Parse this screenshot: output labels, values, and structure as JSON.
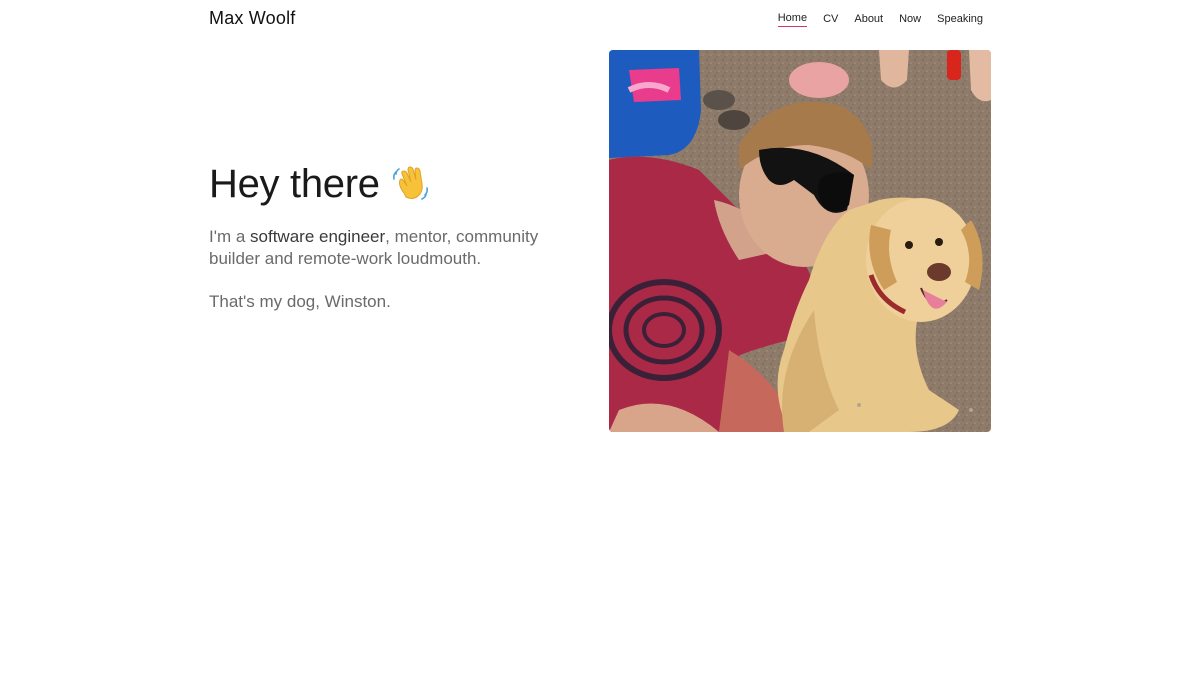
{
  "header": {
    "brand": "Max Woolf",
    "nav": [
      {
        "label": "Home",
        "active": true
      },
      {
        "label": "CV",
        "active": false
      },
      {
        "label": "About",
        "active": false
      },
      {
        "label": "Now",
        "active": false
      },
      {
        "label": "Speaking",
        "active": false
      }
    ]
  },
  "hero": {
    "title": "Hey there",
    "title_icon": "waving-hand-icon",
    "intro_prefix": "I'm a ",
    "intro_strong": "software engineer",
    "intro_suffix": ", mentor, community builder and remote-work loudmouth.",
    "dog_note": "That's my dog, Winston."
  },
  "photo": {
    "icon": "portrait-photo-icon"
  },
  "colors": {
    "accent": "#d6336c",
    "text": "#1f1f1f",
    "muted": "#6a6a6a"
  }
}
